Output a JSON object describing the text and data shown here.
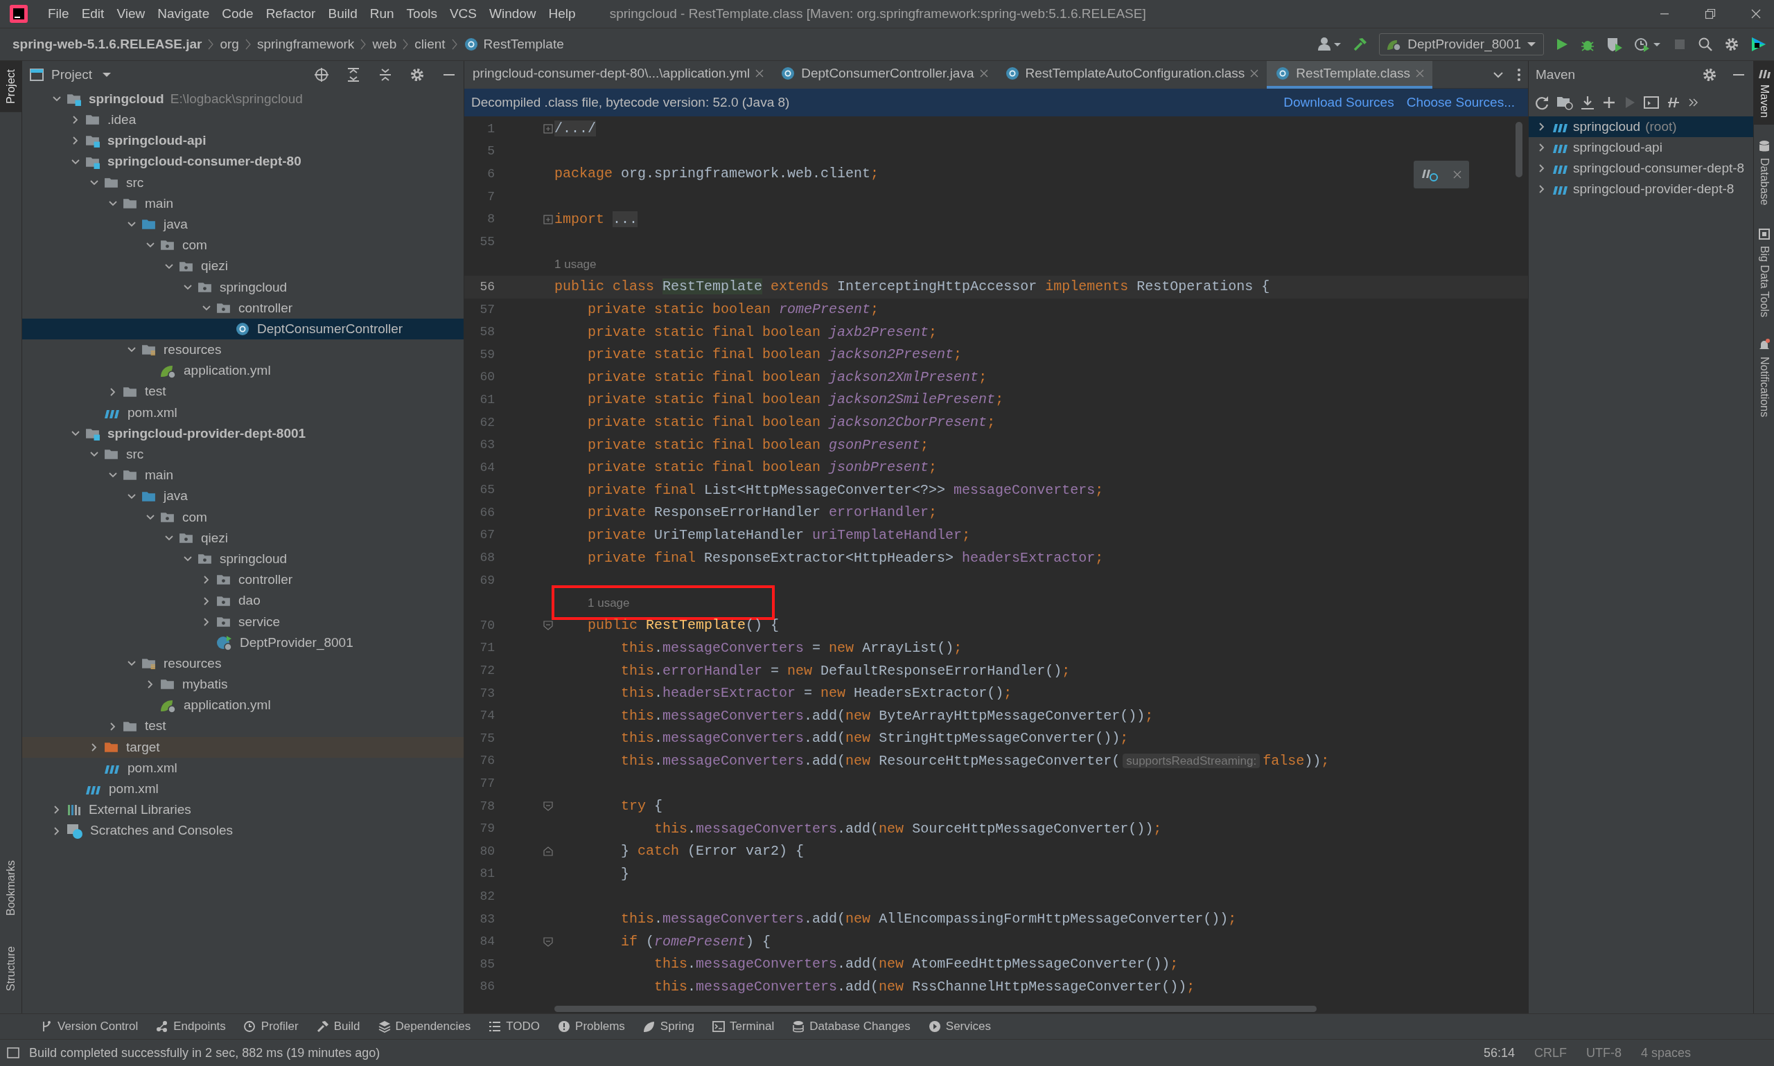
{
  "menu": [
    "File",
    "Edit",
    "View",
    "Navigate",
    "Code",
    "Refactor",
    "Build",
    "Run",
    "Tools",
    "VCS",
    "Window",
    "Help"
  ],
  "window": {
    "title": "springcloud - RestTemplate.class [Maven: org.springframework:spring-web:5.1.6.RELEASE]"
  },
  "breadcrumb": [
    {
      "label": "spring-web-5.1.6.RELEASE.jar",
      "kind": "jar"
    },
    {
      "label": "org",
      "kind": "package"
    },
    {
      "label": "springframework",
      "kind": "package"
    },
    {
      "label": "web",
      "kind": "package"
    },
    {
      "label": "client",
      "kind": "package"
    },
    {
      "label": "RestTemplate",
      "kind": "class"
    }
  ],
  "run_config": {
    "label": "DeptProvider_8001"
  },
  "left_stripe": {
    "top": [
      {
        "label": "Project",
        "selected": true
      }
    ],
    "bottom": [
      {
        "label": "Bookmarks",
        "selected": false
      },
      {
        "label": "Structure",
        "selected": false
      }
    ]
  },
  "project_panel": {
    "title": "Project",
    "tree": [
      {
        "label": "springcloud",
        "hint": "E:\\logback\\springcloud",
        "kind": "module",
        "expanded": true,
        "selected": false,
        "children": [
          {
            "label": ".idea",
            "kind": "folder",
            "expanded": false,
            "selected": false
          },
          {
            "label": "springcloud-api",
            "kind": "module",
            "expanded": false,
            "selected": false
          },
          {
            "label": "springcloud-consumer-dept-80",
            "kind": "module",
            "expanded": true,
            "selected": false,
            "children": [
              {
                "label": "src",
                "kind": "folder",
                "expanded": true,
                "selected": false,
                "children": [
                  {
                    "label": "main",
                    "kind": "folder",
                    "expanded": true,
                    "selected": false,
                    "children": [
                      {
                        "label": "java",
                        "kind": "source",
                        "expanded": true,
                        "selected": false,
                        "children": [
                          {
                            "label": "com",
                            "kind": "package",
                            "expanded": true,
                            "selected": false,
                            "children": [
                              {
                                "label": "qiezi",
                                "kind": "package",
                                "expanded": true,
                                "selected": false,
                                "children": [
                                  {
                                    "label": "springcloud",
                                    "kind": "package",
                                    "expanded": true,
                                    "selected": false,
                                    "children": [
                                      {
                                        "label": "controller",
                                        "kind": "package",
                                        "expanded": true,
                                        "selected": false,
                                        "children": [
                                          {
                                            "label": "DeptConsumerController",
                                            "kind": "class",
                                            "selected": true
                                          }
                                        ]
                                      }
                                    ]
                                  }
                                ]
                              }
                            ]
                          }
                        ]
                      },
                      {
                        "label": "resources",
                        "kind": "resources",
                        "expanded": true,
                        "selected": false,
                        "children": [
                          {
                            "label": "application.yml",
                            "kind": "spring-config",
                            "selected": false
                          }
                        ]
                      }
                    ]
                  },
                  {
                    "label": "test",
                    "kind": "folder",
                    "expanded": false,
                    "selected": false
                  }
                ]
              },
              {
                "label": "pom.xml",
                "kind": "maven",
                "selected": false
              }
            ]
          },
          {
            "label": "springcloud-provider-dept-8001",
            "kind": "module",
            "expanded": true,
            "selected": false,
            "children": [
              {
                "label": "src",
                "kind": "folder",
                "expanded": true,
                "selected": false,
                "children": [
                  {
                    "label": "main",
                    "kind": "folder",
                    "expanded": true,
                    "selected": false,
                    "children": [
                      {
                        "label": "java",
                        "kind": "source",
                        "expanded": true,
                        "selected": false,
                        "children": [
                          {
                            "label": "com",
                            "kind": "package",
                            "expanded": true,
                            "selected": false,
                            "children": [
                              {
                                "label": "qiezi",
                                "kind": "package",
                                "expanded": true,
                                "selected": false,
                                "children": [
                                  {
                                    "label": "springcloud",
                                    "kind": "package",
                                    "expanded": true,
                                    "selected": false,
                                    "children": [
                                      {
                                        "label": "controller",
                                        "kind": "package",
                                        "expanded": false,
                                        "selected": false
                                      },
                                      {
                                        "label": "dao",
                                        "kind": "package",
                                        "expanded": false,
                                        "selected": false
                                      },
                                      {
                                        "label": "service",
                                        "kind": "package",
                                        "expanded": false,
                                        "selected": false
                                      },
                                      {
                                        "label": "DeptProvider_8001",
                                        "kind": "boot-class",
                                        "selected": false
                                      }
                                    ]
                                  }
                                ]
                              }
                            ]
                          }
                        ]
                      },
                      {
                        "label": "resources",
                        "kind": "resources",
                        "expanded": true,
                        "selected": false,
                        "children": [
                          {
                            "label": "mybatis",
                            "kind": "folder",
                            "expanded": false,
                            "selected": false
                          },
                          {
                            "label": "application.yml",
                            "kind": "spring-config",
                            "selected": false
                          }
                        ]
                      }
                    ]
                  },
                  {
                    "label": "test",
                    "kind": "folder",
                    "expanded": false,
                    "selected": false
                  }
                ]
              },
              {
                "label": "target",
                "kind": "excluded",
                "expanded": false,
                "selected": false
              },
              {
                "label": "pom.xml",
                "kind": "maven",
                "selected": false
              }
            ]
          },
          {
            "label": "pom.xml",
            "kind": "maven",
            "selected": false
          }
        ]
      },
      {
        "label": "External Libraries",
        "kind": "libraries",
        "expanded": false,
        "selected": false
      },
      {
        "label": "Scratches and Consoles",
        "kind": "scratches",
        "expanded": false,
        "selected": false
      }
    ]
  },
  "editor": {
    "tabs": [
      {
        "label": "pringcloud-consumer-dept-80\\...\\application.yml",
        "kind": "cut",
        "selected": false
      },
      {
        "label": "DeptConsumerController.java",
        "kind": "class",
        "selected": false
      },
      {
        "label": "RestTemplateAutoConfiguration.class",
        "kind": "class",
        "selected": false
      },
      {
        "label": "RestTemplate.class",
        "kind": "class",
        "selected": true
      }
    ],
    "banner": {
      "text": "Decompiled .class file, bytecode version: 52.0 (Java 8)",
      "actions": [
        "Download Sources",
        "Choose Sources..."
      ]
    },
    "lines": [
      {
        "kind": "code",
        "number": "1",
        "gutter_icon": {
          "kind": "collapsed"
        },
        "tokens": [
          {
            "kind": "folded",
            "text": "/.../"
          }
        ]
      },
      {
        "kind": "code",
        "number": "5"
      },
      {
        "kind": "code",
        "number": "6",
        "tokens": [
          {
            "kind": "keyword",
            "text": "package "
          },
          {
            "kind": "plain",
            "text": "org.springframework.web.client"
          },
          {
            "kind": "keyword",
            "text": ";"
          }
        ]
      },
      {
        "kind": "code",
        "number": "7"
      },
      {
        "kind": "code",
        "number": "8",
        "gutter_icon": {
          "kind": "collapsed"
        },
        "tokens": [
          {
            "kind": "keyword",
            "text": "import "
          },
          {
            "kind": "folded",
            "text": "..."
          }
        ]
      },
      {
        "kind": "code",
        "number": "55"
      },
      {
        "kind": "usage",
        "text": "1 usage",
        "boxed": false
      },
      {
        "kind": "code",
        "number": "56",
        "current": true,
        "tokens": [
          {
            "kind": "keyword",
            "text": "public class "
          },
          {
            "kind": "declaration",
            "text": "RestTemplate"
          },
          {
            "kind": "keyword",
            "text": " extends "
          },
          {
            "kind": "plain",
            "text": "InterceptingHttpAccessor "
          },
          {
            "kind": "keyword",
            "text": "implements "
          },
          {
            "kind": "plain",
            "text": "RestOperations {"
          }
        ]
      },
      {
        "kind": "code",
        "number": "57",
        "tokens": [
          {
            "kind": "keyword",
            "text": "    private static boolean "
          },
          {
            "kind": "static",
            "text": "romePresent"
          },
          {
            "kind": "keyword",
            "text": ";"
          }
        ]
      },
      {
        "kind": "code",
        "number": "58",
        "tokens": [
          {
            "kind": "keyword",
            "text": "    private static final boolean "
          },
          {
            "kind": "static",
            "text": "jaxb2Present"
          },
          {
            "kind": "keyword",
            "text": ";"
          }
        ]
      },
      {
        "kind": "code",
        "number": "59",
        "tokens": [
          {
            "kind": "keyword",
            "text": "    private static final boolean "
          },
          {
            "kind": "static",
            "text": "jackson2Present"
          },
          {
            "kind": "keyword",
            "text": ";"
          }
        ]
      },
      {
        "kind": "code",
        "number": "60",
        "tokens": [
          {
            "kind": "keyword",
            "text": "    private static final boolean "
          },
          {
            "kind": "static",
            "text": "jackson2XmlPresent"
          },
          {
            "kind": "keyword",
            "text": ";"
          }
        ]
      },
      {
        "kind": "code",
        "number": "61",
        "tokens": [
          {
            "kind": "keyword",
            "text": "    private static final boolean "
          },
          {
            "kind": "static",
            "text": "jackson2SmilePresent"
          },
          {
            "kind": "keyword",
            "text": ";"
          }
        ]
      },
      {
        "kind": "code",
        "number": "62",
        "tokens": [
          {
            "kind": "keyword",
            "text": "    private static final boolean "
          },
          {
            "kind": "static",
            "text": "jackson2CborPresent"
          },
          {
            "kind": "keyword",
            "text": ";"
          }
        ]
      },
      {
        "kind": "code",
        "number": "63",
        "tokens": [
          {
            "kind": "keyword",
            "text": "    private static final boolean "
          },
          {
            "kind": "static",
            "text": "gsonPresent"
          },
          {
            "kind": "keyword",
            "text": ";"
          }
        ]
      },
      {
        "kind": "code",
        "number": "64",
        "tokens": [
          {
            "kind": "keyword",
            "text": "    private static final boolean "
          },
          {
            "kind": "static",
            "text": "jsonbPresent"
          },
          {
            "kind": "keyword",
            "text": ";"
          }
        ]
      },
      {
        "kind": "code",
        "number": "65",
        "tokens": [
          {
            "kind": "keyword",
            "text": "    private final "
          },
          {
            "kind": "plain",
            "text": "List<HttpMessageConverter<?>> "
          },
          {
            "kind": "field",
            "text": "messageConverters"
          },
          {
            "kind": "keyword",
            "text": ";"
          }
        ]
      },
      {
        "kind": "code",
        "number": "66",
        "tokens": [
          {
            "kind": "keyword",
            "text": "    private "
          },
          {
            "kind": "plain",
            "text": "ResponseErrorHandler "
          },
          {
            "kind": "field",
            "text": "errorHandler"
          },
          {
            "kind": "keyword",
            "text": ";"
          }
        ]
      },
      {
        "kind": "code",
        "number": "67",
        "tokens": [
          {
            "kind": "keyword",
            "text": "    private "
          },
          {
            "kind": "plain",
            "text": "UriTemplateHandler "
          },
          {
            "kind": "field",
            "text": "uriTemplateHandler"
          },
          {
            "kind": "keyword",
            "text": ";"
          }
        ]
      },
      {
        "kind": "code",
        "number": "68",
        "tokens": [
          {
            "kind": "keyword",
            "text": "    private final "
          },
          {
            "kind": "plain",
            "text": "ResponseExtractor<HttpHeaders> "
          },
          {
            "kind": "field",
            "text": "headersExtractor"
          },
          {
            "kind": "keyword",
            "text": ";"
          }
        ]
      },
      {
        "kind": "code",
        "number": "69"
      },
      {
        "kind": "usage",
        "text": "1 usage",
        "boxed": true
      },
      {
        "kind": "code",
        "number": "70",
        "gutter_icon": {
          "kind": "start"
        },
        "tokens": [
          {
            "kind": "keyword",
            "text": "    public "
          },
          {
            "kind": "method",
            "text": "RestTemplate"
          },
          {
            "kind": "plain",
            "text": "() {"
          }
        ]
      },
      {
        "kind": "code",
        "number": "71",
        "tokens": [
          {
            "kind": "keyword",
            "text": "        this"
          },
          {
            "kind": "plain",
            "text": "."
          },
          {
            "kind": "field",
            "text": "messageConverters"
          },
          {
            "kind": "plain",
            "text": " = "
          },
          {
            "kind": "keyword",
            "text": "new "
          },
          {
            "kind": "plain",
            "text": "ArrayList()"
          },
          {
            "kind": "keyword",
            "text": ";"
          }
        ]
      },
      {
        "kind": "code",
        "number": "72",
        "tokens": [
          {
            "kind": "keyword",
            "text": "        this"
          },
          {
            "kind": "plain",
            "text": "."
          },
          {
            "kind": "field",
            "text": "errorHandler"
          },
          {
            "kind": "plain",
            "text": " = "
          },
          {
            "kind": "keyword",
            "text": "new "
          },
          {
            "kind": "plain",
            "text": "DefaultResponseErrorHandler()"
          },
          {
            "kind": "keyword",
            "text": ";"
          }
        ]
      },
      {
        "kind": "code",
        "number": "73",
        "tokens": [
          {
            "kind": "keyword",
            "text": "        this"
          },
          {
            "kind": "plain",
            "text": "."
          },
          {
            "kind": "field",
            "text": "headersExtractor"
          },
          {
            "kind": "plain",
            "text": " = "
          },
          {
            "kind": "keyword",
            "text": "new "
          },
          {
            "kind": "plain",
            "text": "HeadersExtractor()"
          },
          {
            "kind": "keyword",
            "text": ";"
          }
        ]
      },
      {
        "kind": "code",
        "number": "74",
        "tokens": [
          {
            "kind": "keyword",
            "text": "        this"
          },
          {
            "kind": "plain",
            "text": "."
          },
          {
            "kind": "field",
            "text": "messageConverters"
          },
          {
            "kind": "plain",
            "text": ".add("
          },
          {
            "kind": "keyword",
            "text": "new "
          },
          {
            "kind": "plain",
            "text": "ByteArrayHttpMessageConverter())"
          },
          {
            "kind": "keyword",
            "text": ";"
          }
        ]
      },
      {
        "kind": "code",
        "number": "75",
        "tokens": [
          {
            "kind": "keyword",
            "text": "        this"
          },
          {
            "kind": "plain",
            "text": "."
          },
          {
            "kind": "field",
            "text": "messageConverters"
          },
          {
            "kind": "plain",
            "text": ".add("
          },
          {
            "kind": "keyword",
            "text": "new "
          },
          {
            "kind": "plain",
            "text": "StringHttpMessageConverter())"
          },
          {
            "kind": "keyword",
            "text": ";"
          }
        ]
      },
      {
        "kind": "code",
        "number": "76",
        "tokens": [
          {
            "kind": "keyword",
            "text": "        this"
          },
          {
            "kind": "plain",
            "text": "."
          },
          {
            "kind": "field",
            "text": "messageConverters"
          },
          {
            "kind": "plain",
            "text": ".add("
          },
          {
            "kind": "keyword",
            "text": "new "
          },
          {
            "kind": "plain",
            "text": "ResourceHttpMessageConverter("
          },
          {
            "kind": "hint",
            "text": "supportsReadStreaming:"
          },
          {
            "kind": "keyword",
            "text": "false"
          },
          {
            "kind": "plain",
            "text": "))"
          },
          {
            "kind": "keyword",
            "text": ";"
          }
        ]
      },
      {
        "kind": "code",
        "number": "77"
      },
      {
        "kind": "code",
        "number": "78",
        "gutter_icon": {
          "kind": "start"
        },
        "tokens": [
          {
            "kind": "keyword",
            "text": "        try "
          },
          {
            "kind": "plain",
            "text": "{"
          }
        ]
      },
      {
        "kind": "code",
        "number": "79",
        "tokens": [
          {
            "kind": "keyword",
            "text": "            this"
          },
          {
            "kind": "plain",
            "text": "."
          },
          {
            "kind": "field",
            "text": "messageConverters"
          },
          {
            "kind": "plain",
            "text": ".add("
          },
          {
            "kind": "keyword",
            "text": "new "
          },
          {
            "kind": "plain",
            "text": "SourceHttpMessageConverter())"
          },
          {
            "kind": "keyword",
            "text": ";"
          }
        ]
      },
      {
        "kind": "code",
        "number": "80",
        "gutter_icon": {
          "kind": "end"
        },
        "tokens": [
          {
            "kind": "plain",
            "text": "        } "
          },
          {
            "kind": "keyword",
            "text": "catch "
          },
          {
            "kind": "plain",
            "text": "(Error var2) {"
          }
        ]
      },
      {
        "kind": "code",
        "number": "81",
        "tokens": [
          {
            "kind": "plain",
            "text": "        }"
          }
        ]
      },
      {
        "kind": "code",
        "number": "82"
      },
      {
        "kind": "code",
        "number": "83",
        "tokens": [
          {
            "kind": "keyword",
            "text": "        this"
          },
          {
            "kind": "plain",
            "text": "."
          },
          {
            "kind": "field",
            "text": "messageConverters"
          },
          {
            "kind": "plain",
            "text": ".add("
          },
          {
            "kind": "keyword",
            "text": "new "
          },
          {
            "kind": "plain",
            "text": "AllEncompassingFormHttpMessageConverter())"
          },
          {
            "kind": "keyword",
            "text": ";"
          }
        ]
      },
      {
        "kind": "code",
        "number": "84",
        "gutter_icon": {
          "kind": "start"
        },
        "tokens": [
          {
            "kind": "keyword",
            "text": "        if "
          },
          {
            "kind": "plain",
            "text": "("
          },
          {
            "kind": "static",
            "text": "romePresent"
          },
          {
            "kind": "plain",
            "text": ") {"
          }
        ]
      },
      {
        "kind": "code",
        "number": "85",
        "tokens": [
          {
            "kind": "keyword",
            "text": "            this"
          },
          {
            "kind": "plain",
            "text": "."
          },
          {
            "kind": "field",
            "text": "messageConverters"
          },
          {
            "kind": "plain",
            "text": ".add("
          },
          {
            "kind": "keyword",
            "text": "new "
          },
          {
            "kind": "plain",
            "text": "AtomFeedHttpMessageConverter())"
          },
          {
            "kind": "keyword",
            "text": ";"
          }
        ]
      },
      {
        "kind": "code",
        "number": "86",
        "tokens": [
          {
            "kind": "keyword",
            "text": "            this"
          },
          {
            "kind": "plain",
            "text": "."
          },
          {
            "kind": "field",
            "text": "messageConverters"
          },
          {
            "kind": "plain",
            "text": ".add("
          },
          {
            "kind": "keyword",
            "text": "new "
          },
          {
            "kind": "plain",
            "text": "RssChannelHttpMessageConverter())"
          },
          {
            "kind": "keyword",
            "text": ";"
          }
        ]
      }
    ]
  },
  "maven": {
    "title": "Maven",
    "items": [
      {
        "label": "springcloud",
        "suffix": "(root)",
        "selected": true
      },
      {
        "label": "springcloud-api",
        "selected": false
      },
      {
        "label": "springcloud-consumer-dept-8",
        "selected": false
      },
      {
        "label": "springcloud-provider-dept-8",
        "selected": false
      }
    ]
  },
  "right_stripe": [
    {
      "label": "Maven",
      "kind": "maven",
      "selected": true
    },
    {
      "label": "Database",
      "kind": "database",
      "selected": false
    },
    {
      "label": "Big Data Tools",
      "kind": "bigdata",
      "selected": false
    },
    {
      "label": "Notifications",
      "kind": "bell",
      "selected": false
    }
  ],
  "tool_windows": [
    {
      "label": "Version Control",
      "kind": "vcs"
    },
    {
      "label": "Endpoints",
      "kind": "endpoints"
    },
    {
      "label": "Profiler",
      "kind": "profiler"
    },
    {
      "label": "Build",
      "kind": "build"
    },
    {
      "label": "Dependencies",
      "kind": "dependencies"
    },
    {
      "label": "TODO",
      "kind": "todo"
    },
    {
      "label": "Problems",
      "kind": "problems"
    },
    {
      "label": "Spring",
      "kind": "spring"
    },
    {
      "label": "Terminal",
      "kind": "terminal"
    },
    {
      "label": "Database Changes",
      "kind": "dbchanges"
    },
    {
      "label": "Services",
      "kind": "services"
    }
  ],
  "status_bar": {
    "message": "Build completed successfully in 2 sec, 882 ms (19 minutes ago)",
    "items": [
      "56:14",
      "CRLF",
      "UTF-8",
      "4 spaces"
    ]
  }
}
